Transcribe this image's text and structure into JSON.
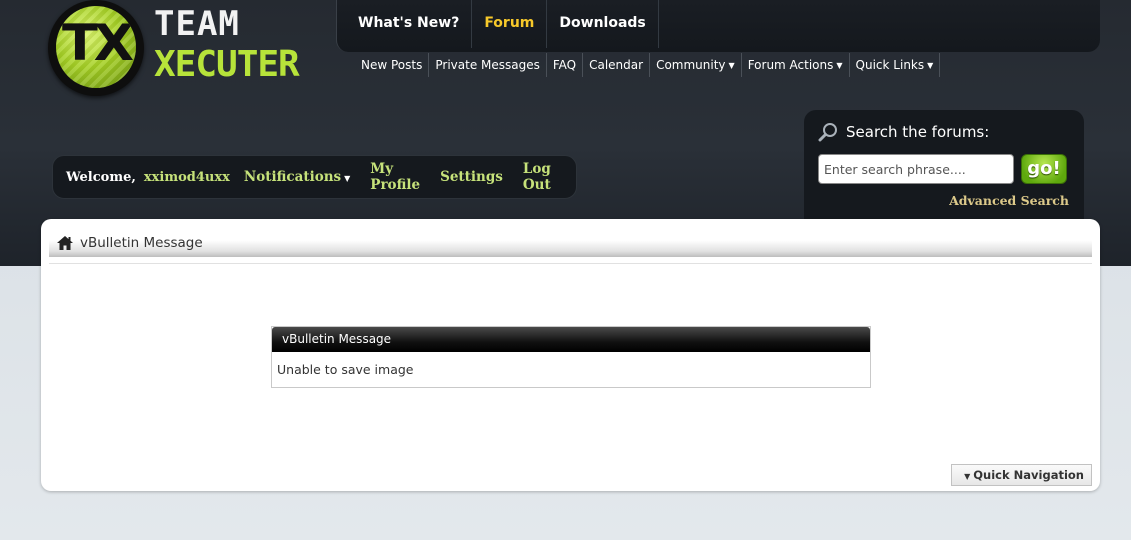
{
  "logo": {
    "mark": "TX",
    "line1": "TEAM",
    "line2": "XECUTER"
  },
  "topnav": {
    "tabs": [
      {
        "label": "What's New?"
      },
      {
        "label": "Forum"
      },
      {
        "label": "Downloads"
      }
    ]
  },
  "subnav": {
    "items": [
      {
        "label": "New Posts"
      },
      {
        "label": "Private Messages"
      },
      {
        "label": "FAQ"
      },
      {
        "label": "Calendar"
      },
      {
        "label": "Community"
      },
      {
        "label": "Forum Actions"
      },
      {
        "label": "Quick Links"
      }
    ]
  },
  "welcome": {
    "label": "Welcome,",
    "username": "xximod4uxx",
    "notifications": "Notifications",
    "profile": "My Profile",
    "settings": "Settings",
    "logout": "Log Out"
  },
  "search": {
    "title": "Search the forums:",
    "placeholder": "Enter search phrase....",
    "go": "go!",
    "advanced": "Advanced Search"
  },
  "breadcrumb": {
    "label": "vBulletin Message"
  },
  "message": {
    "title": "vBulletin Message",
    "body": "Unable to save image"
  },
  "quick_nav": {
    "label": "Quick Navigation"
  },
  "colors": {
    "accent_yellow": "#f7c92a",
    "link_green": "#c6e27a",
    "go_green": "#5ea80d"
  }
}
